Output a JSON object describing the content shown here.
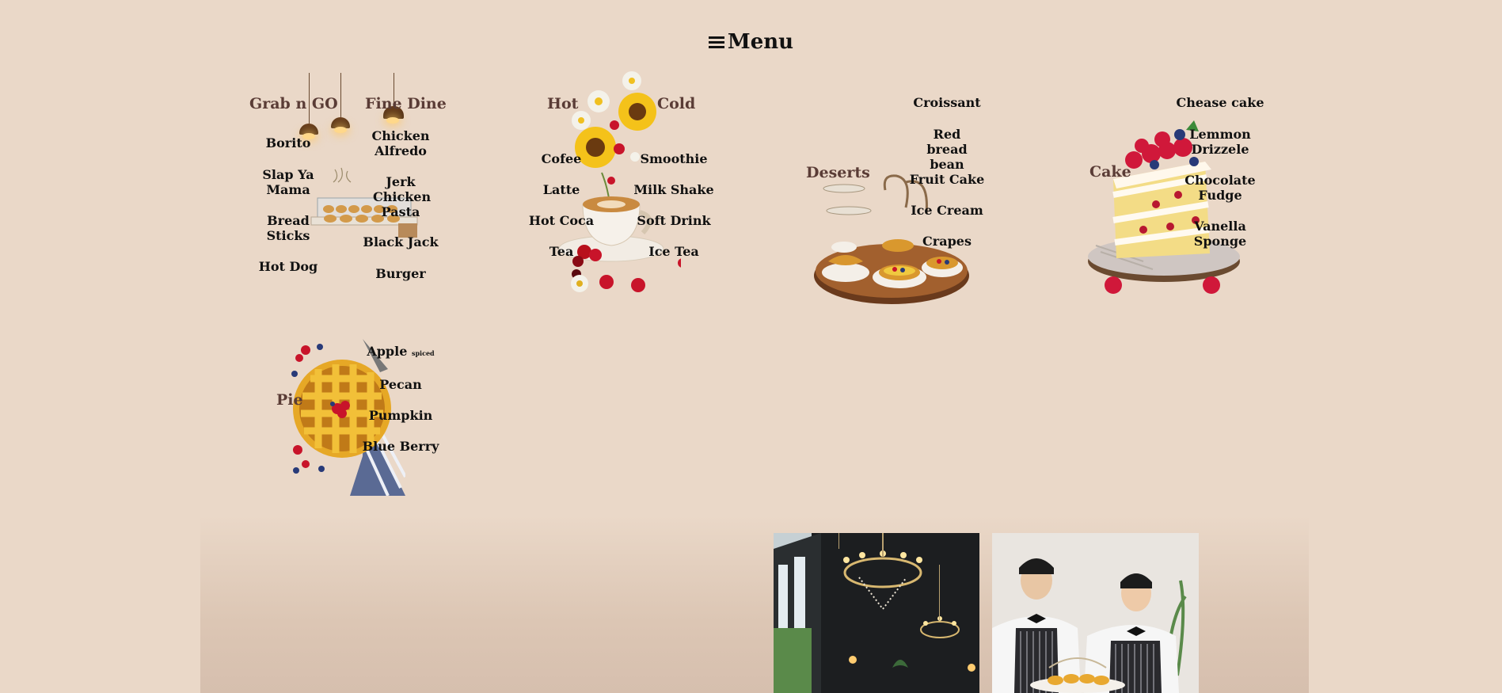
{
  "header": {
    "title": "Menu",
    "icon": "hamburger-menu-icon"
  },
  "sections": {
    "grab": {
      "title_left": "Grab n GO",
      "title_right": "Fine Dine",
      "left_items": [
        "Borito",
        "Slap Ya Mama",
        "Bread Sticks",
        "Hot Dog"
      ],
      "right_items": [
        "Chicken Alfredo",
        "Jerk Chicken Pasta",
        "Black Jack",
        "Burger"
      ]
    },
    "drinks": {
      "title_left": "Hot",
      "title_right": "Cold",
      "left_items": [
        "Cofee",
        "Latte",
        "Hot Coca",
        "Tea"
      ],
      "right_items": [
        "Smoothie",
        "Milk Shake",
        "Soft Drink",
        "Ice Tea"
      ]
    },
    "deserts": {
      "title": "Deserts",
      "items": [
        "Croissant",
        "Red bread bean",
        "Fruit Cake",
        "Ice Cream",
        "Crapes"
      ]
    },
    "cake": {
      "title": "Cake",
      "items": [
        "Chease cake",
        "Lemmon Drizzele",
        "Chocolate Fudge",
        "Vanella Sponge"
      ]
    },
    "pie": {
      "title": "Pie",
      "item_apple": "Apple",
      "item_apple_note": "spiced",
      "items": [
        "Pecan",
        "Pumpkin",
        "Blue Berry"
      ]
    }
  },
  "colors": {
    "background": "#ead8c8",
    "category_text": "#5a3c36",
    "item_text": "#111111"
  }
}
